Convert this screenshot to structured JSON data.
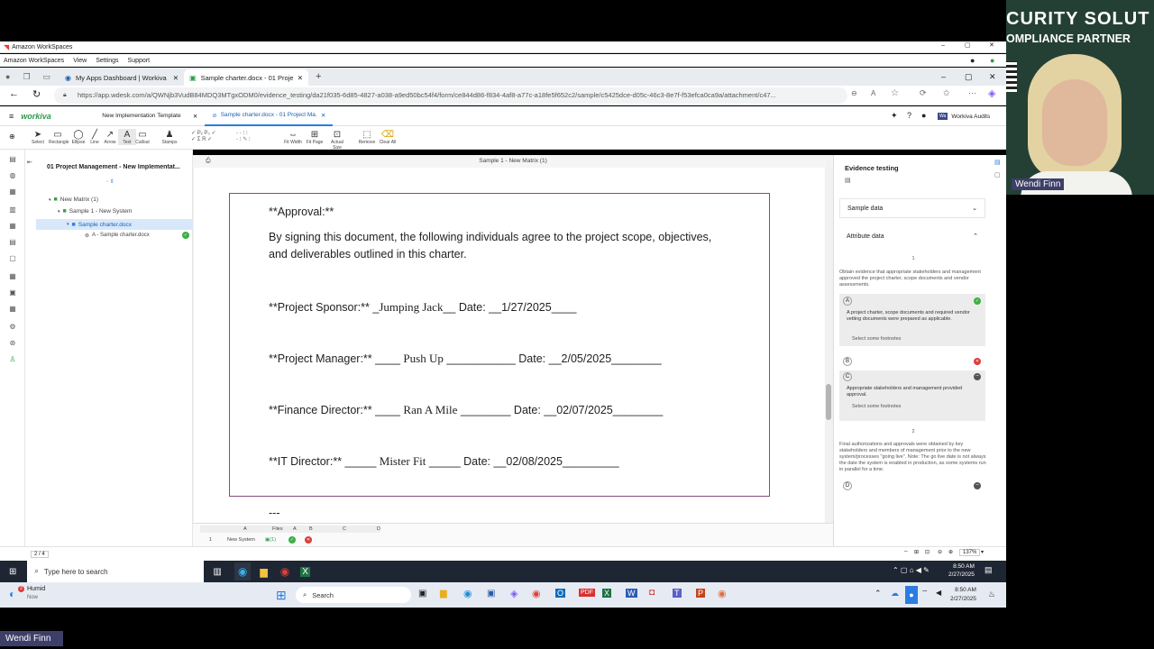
{
  "workspaces": {
    "title": "Amazon WorkSpaces",
    "menu": [
      "Amazon WorkSpaces",
      "View",
      "Settings",
      "Support"
    ]
  },
  "browser": {
    "tabs": [
      {
        "label": "My Apps Dashboard | Workiva"
      },
      {
        "label": "Sample charter.docx - 01 Project"
      }
    ],
    "url": "https://app.wdesk.com/a/QWNjb3VudB84MDQ3MTgxODM0/evidence_testing/da21f035-6d85-4827-a038-a9ed50bc54f4/form/ce844d86-f834-4af8-a77c-a18fe5f652c2/sample/c5425dce-d05c-46c3-8e7f-f53efca0ca9a/attachment/c47..."
  },
  "workiva": {
    "logo": "workiva",
    "tabs": [
      {
        "label": "New Implementation Template"
      },
      {
        "label": "Sample charter.docx - 01 Project Ma..."
      }
    ],
    "audits_label": "Workiva Audits",
    "audits_badge": "Wa"
  },
  "toolbar": {
    "tools": [
      "Select",
      "Rectangle",
      "Ellipse",
      "Line",
      "Arrow",
      "Text",
      "Callout",
      "Stamps",
      "Fit Width",
      "Fit Page",
      "Actual Size",
      "Remove",
      "Clear All"
    ]
  },
  "outline": {
    "title": "01 Project Management - New Implementat...",
    "items": [
      "New Matrix (1)",
      "Sample 1 - New System",
      "Sample charter.docx",
      "A - Sample charter.docx"
    ]
  },
  "canvas": {
    "header": "Sample 1 - New Matrix (1)"
  },
  "document": {
    "approval_heading": "**Approval:**",
    "intro_line1": "By signing this document, the following individuals agree to the project scope, objectives,",
    "intro_line2": "and deliverables outlined in this charter.",
    "rows": [
      {
        "label": "**Project Sponsor:**",
        "pre": " _",
        "name": "Jumping Jack",
        "post": "__ Date: __",
        "date": "1/27/2025",
        "tail": "____"
      },
      {
        "label": "**Project Manager:**",
        "pre": " ____ ",
        "name": "Push Up",
        "post": " ___________ Date: __",
        "date": "2/05/2025",
        "tail": "________"
      },
      {
        "label": "**Finance Director:**",
        "pre": " ____ ",
        "name": "Ran A Mile",
        "post": " ________ Date: __",
        "date": "02/07/2025",
        "tail": "________"
      },
      {
        "label": "**IT Director:**",
        "pre": " _____ ",
        "name": "Mister Fit",
        "post": " _____ Date: __",
        "date": "02/08/2025",
        "tail": "_________"
      }
    ],
    "separator": "---"
  },
  "matrix": {
    "headers": [
      "A",
      "Files",
      "A",
      "B",
      "C",
      "D"
    ],
    "row_num": "1",
    "row_label": "New System",
    "files": "(1)"
  },
  "right_panel": {
    "title": "Evidence testing",
    "sample_data": "Sample data",
    "attribute_data": "Attribute data",
    "step1": "1",
    "step1_text": "Obtain evidence that appropriate stakeholders and management approved the project charter, scope documents and vendor assessments.",
    "attrA": "A",
    "attrA_text": "A project charter, scope documents and required vendor vetting documents were prepared as applicable.",
    "footnotes": "Select some footnotes",
    "attrB": "B",
    "attrC": "C",
    "attrC_text": "Appropriate stakeholders and management provided approval.",
    "step2": "2",
    "step2_text": "Final authorizations and approvals were obtained by key stakeholders and members of management prior to the new system/processes \"going live\". Note: The go live date is not always the date the system is enabled in production, as some systems run in parallel for a time.",
    "attrD": "D"
  },
  "status": {
    "pages": "2 / 4",
    "zoom": "137%"
  },
  "taskbar": {
    "search_placeholder": "Type here to search",
    "time": "8:50 AM",
    "date": "2/27/2025"
  },
  "taskbar2": {
    "weather": "Humid",
    "weather_sub": "Now",
    "weather_badge": "2",
    "search": "Search",
    "time": "8:50 AM",
    "date": "2/27/2025"
  },
  "video": {
    "banner1": "CURITY SOLUT",
    "banner2": "OMPLIANCE PARTNER",
    "name": "Wendi Finn"
  },
  "presenter": {
    "name": "Wendi Finn"
  }
}
